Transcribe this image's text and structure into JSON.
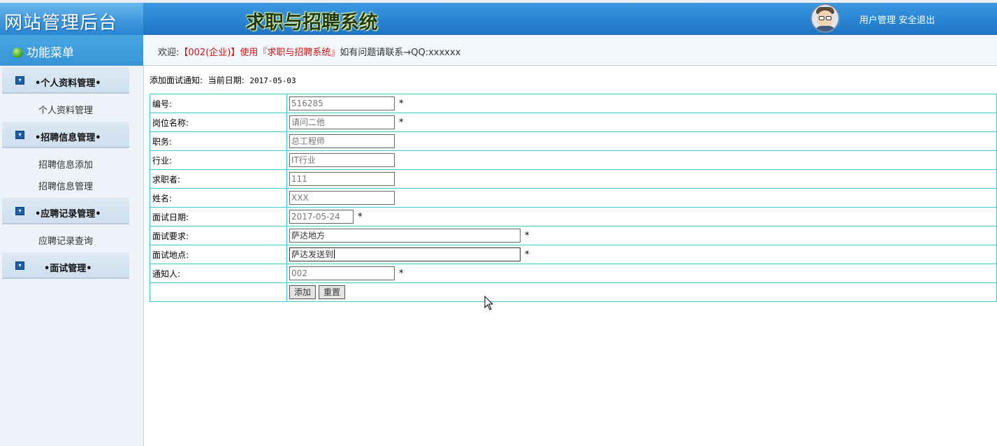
{
  "header": {
    "logo_text": "网站管理后台",
    "system_title": "求职与招聘系统",
    "links": [
      "用户管理",
      "安全退出"
    ]
  },
  "subbar": {
    "menu_title": "功能菜单",
    "welcome_prefix": "欢迎:",
    "welcome_user": "【002(企业)】使用『求职与招聘系统』",
    "welcome_suffix": "如有问题请联系→QQ:xxxxxx"
  },
  "sidebar": {
    "sections": [
      {
        "label": "•个人资料管理•",
        "items": [
          "个人资料管理"
        ]
      },
      {
        "label": "•招聘信息管理•",
        "items": [
          "招聘信息添加",
          "招聘信息管理"
        ]
      },
      {
        "label": "•应聘记录管理•",
        "items": [
          "应聘记录查询"
        ]
      },
      {
        "label": "•面试管理•",
        "items": []
      }
    ]
  },
  "page": {
    "caption": "添加面试通知:",
    "date_label": "当前日期:",
    "date": "2017-05-03"
  },
  "form": {
    "required_mark": "*",
    "fields": [
      {
        "label": "编号:",
        "value": "516285"
      },
      {
        "label": "岗位名称:",
        "value": "请问二他"
      },
      {
        "label": "职务:",
        "value": "总工程师"
      },
      {
        "label": "行业:",
        "value": "IT行业"
      },
      {
        "label": "求职者:",
        "value": "111"
      },
      {
        "label": "姓名:",
        "value": "XXX"
      },
      {
        "label": "面试日期:",
        "value": "2017-05-24"
      },
      {
        "label": "面试要求:",
        "value": "萨达地方"
      },
      {
        "label": "面试地点:",
        "value": "萨达发送到"
      },
      {
        "label": "通知人:",
        "value": "002"
      }
    ],
    "submit_label": "添加",
    "reset_label": "重置"
  }
}
